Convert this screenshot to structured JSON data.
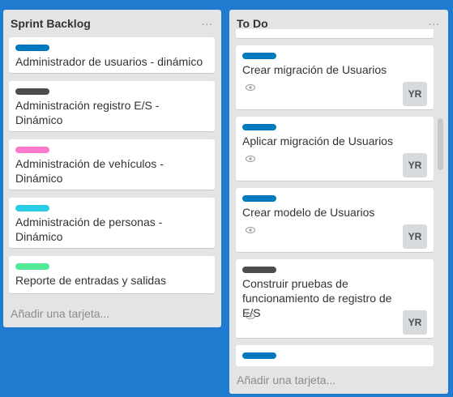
{
  "lists": [
    {
      "title": "Sprint Backlog",
      "menu": "...",
      "add_card": "Añadir una tarjeta...",
      "cards": [
        {
          "label_color": "#0079bf",
          "title": "Administrador de usuarios - dinámico"
        },
        {
          "label_color": "#4d4d4d",
          "title": "Administración registro E/S - Dinámico"
        },
        {
          "label_color": "#ff78cb",
          "title": "Administración de vehículos - Dinámico"
        },
        {
          "label_color": "#29cce5",
          "title": "Administración de personas - Dinámico"
        },
        {
          "label_color": "#51e898",
          "title": "Reporte de entradas y salidas"
        }
      ]
    },
    {
      "title": "To Do",
      "menu": "...",
      "add_card": "Añadir una tarjeta...",
      "cards": [
        {
          "label_color": "#0079bf",
          "title": "Crear migración de Usuarios",
          "watch_icon": "eye-icon",
          "member": "YR"
        },
        {
          "label_color": "#0079bf",
          "title": "Aplicar migración de Usuarios",
          "watch_icon": "eye-icon",
          "member": "YR"
        },
        {
          "label_color": "#0079bf",
          "title": "Crear modelo de Usuarios",
          "watch_icon": "eye-icon",
          "member": "YR"
        },
        {
          "label_color": "#4d4d4d",
          "title": "Construir pruebas de funcionamiento de registro de E/S",
          "watch_icon": "eye-icon",
          "member": "YR"
        },
        {
          "label_color": "#0079bf",
          "title": "",
          "member": ""
        }
      ]
    }
  ]
}
